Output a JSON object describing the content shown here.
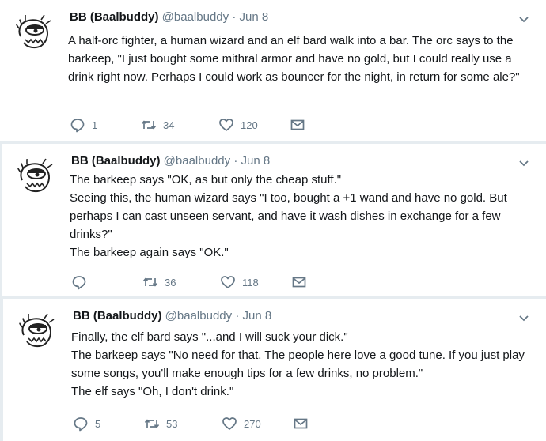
{
  "colors": {
    "background": "#e6ecf0",
    "card": "#ffffff",
    "secondary_text": "#657786",
    "primary_text": "#14171a"
  },
  "tweets": [
    {
      "name": "BB (Baalbuddy)",
      "handle": "@baalbuddy",
      "separator": "·",
      "date": "Jun 8",
      "lines": [
        "A half-orc fighter, a human wizard and an elf bard walk into a bar. The orc says to the barkeep, \"I just bought some mithral armor and have no gold, but I could really use a drink right now. Perhaps I could work as bouncer for the night, in return for some ale?\""
      ],
      "replies": "1",
      "retweets": "34",
      "likes": "120"
    },
    {
      "name": "BB (Baalbuddy)",
      "handle": "@baalbuddy",
      "separator": "·",
      "date": "Jun 8",
      "lines": [
        "The barkeep says \"OK, as but only the cheap stuff.\"",
        "Seeing this, the human wizard says \"I too, bought a +1 wand and have no gold. But perhaps I can cast unseen servant, and have it wash dishes in exchange for a few drinks?\"",
        "The barkeep again says \"OK.\""
      ],
      "replies": "",
      "retweets": "36",
      "likes": "118"
    },
    {
      "name": "BB (Baalbuddy)",
      "handle": "@baalbuddy",
      "separator": "·",
      "date": "Jun 8",
      "lines": [
        "Finally, the elf bard says \"...and I will suck your dick.\"",
        "The barkeep says \"No need for that. The people here love a good tune. If you just play some songs, you'll make enough tips for a few drinks, no problem.\"",
        "The elf says \"Oh, I don't drink.\""
      ],
      "replies": "5",
      "retweets": "53",
      "likes": "270"
    }
  ],
  "icons": {
    "reply": "reply-icon",
    "retweet": "retweet-icon",
    "like": "heart-icon",
    "message": "envelope-icon",
    "menu": "chevron-down-icon"
  }
}
